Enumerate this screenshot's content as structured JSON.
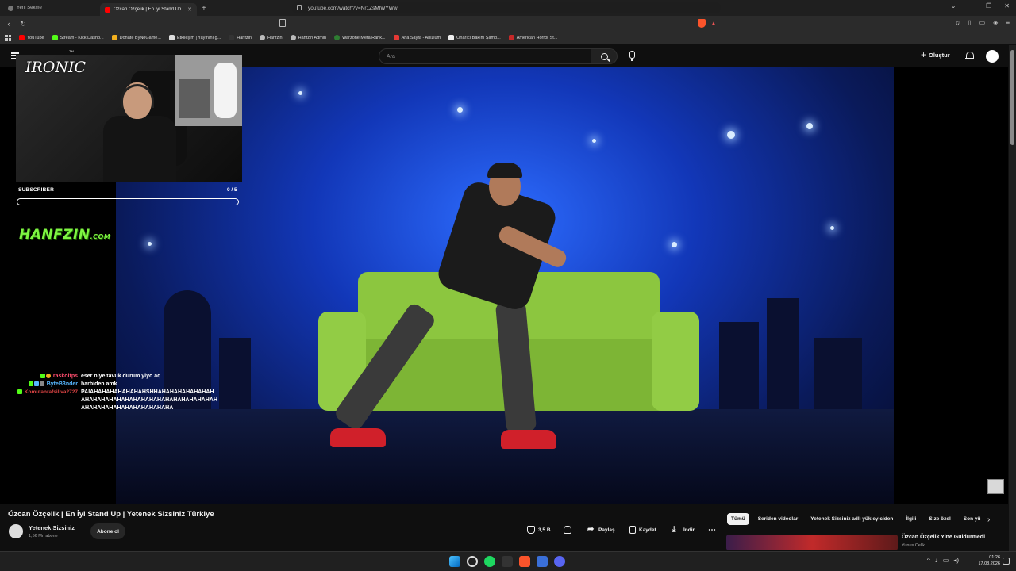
{
  "browser": {
    "tabs": [
      {
        "title": "Yeni Sekme"
      },
      {
        "title": "Özcan Özçelik | En İyi Stand Up"
      }
    ],
    "url": "youtube.com/watch?v=Nr1ZsMlWYWw",
    "bookmarks": [
      "YouTube",
      "Stream - Kick Dashb...",
      "Donate ByNoGame...",
      "Etkileşim | Yayınını g...",
      "Hanfzin",
      "Hanfzin",
      "Hanfzin Admin",
      "Warzone Meta Rank...",
      "Ana Sayfa - Anizium",
      "Onarıcı Bakım Şamp...",
      "American Horror St..."
    ]
  },
  "youtube": {
    "search_placeholder": "Ara",
    "create_label": "Oluştur"
  },
  "overlay": {
    "brand": "IRONIC",
    "brand_tm": "TM",
    "subscriber_label": "SUBSCRIBER",
    "subscriber_count": "0 / 5",
    "subscriber_progress": 0,
    "site": "HANFZIN",
    "site_suffix": ".COM",
    "chat": [
      {
        "user": "raskolfps",
        "user_color": "#ff4d6d",
        "message": "eser niye tavuk dürüm yiyo aq"
      },
      {
        "user": "ByteB3nder",
        "user_color": "#57b7ff",
        "message": "harbiden amk"
      },
      {
        "user": "Komutanrafsiliva2727",
        "user_color": "#e04545",
        "message": "PAIAHAHAHAHAHAHAHSHHAHAHAHAHAHAHAHAHAHAHAHAHAHAHAHAHAHAHAHAHAHAHAHAHAHAHAHAHAHAHAHAHAHAHAHA"
      }
    ]
  },
  "video": {
    "title": "Özcan Özçelik | En İyi Stand Up | Yetenek Sizsiniz Türkiye",
    "channel": "Yetenek Sizsiniz",
    "subscribers": "1,56 Mn abone",
    "subscribe_label": "Abone ol",
    "likes": "3,5 B",
    "share_label": "Paylaş",
    "save_label": "Kaydet",
    "download_label": "İndir"
  },
  "recommendations": {
    "chips": [
      "Tümü",
      "Seriden videolar",
      "Yetenek Sizsiniz adlı yükleyiciden",
      "İlgili",
      "Size özel",
      "Son yü"
    ],
    "first": {
      "title": "Özcan Özçelik Yine Güldürmedi",
      "channel": "Yunus Celik"
    }
  },
  "taskbar": {
    "time": "01:26",
    "date": "17.08.2026"
  },
  "colors": {
    "accent_green": "#7ef542",
    "youtube_red": "#ff0000"
  }
}
